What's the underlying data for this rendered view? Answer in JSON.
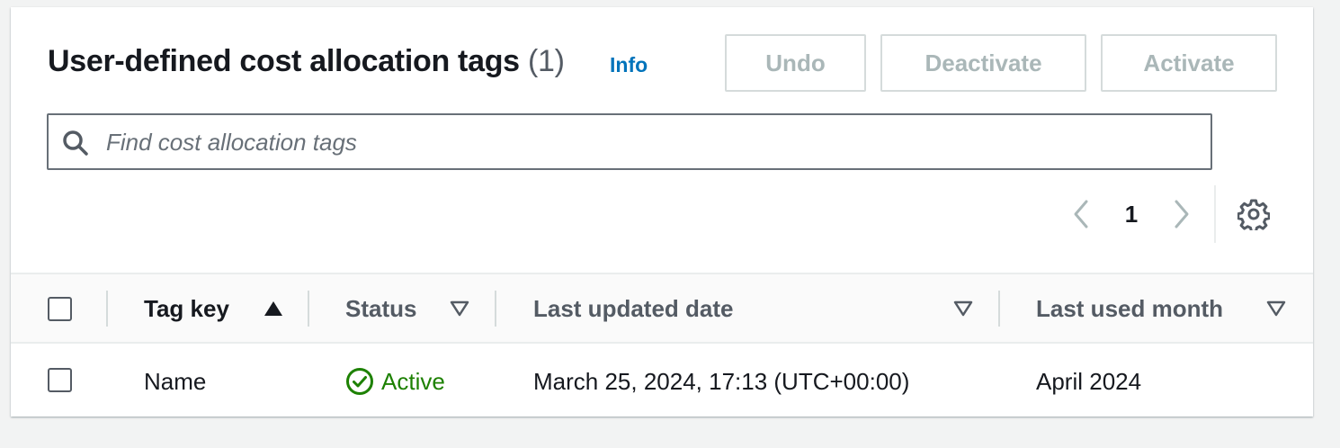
{
  "header": {
    "title": "User-defined cost allocation tags",
    "count": "(1)",
    "info_label": "Info"
  },
  "actions": {
    "undo_label": "Undo",
    "deactivate_label": "Deactivate",
    "activate_label": "Activate"
  },
  "search": {
    "placeholder": "Find cost allocation tags",
    "value": "",
    "icon": "search-icon"
  },
  "pagination": {
    "current_page": "1",
    "prev_icon": "chevron-left-icon",
    "next_icon": "chevron-right-icon",
    "settings_icon": "gear-icon"
  },
  "table": {
    "columns": [
      {
        "label": "Tag key",
        "sort": "ascending"
      },
      {
        "label": "Status",
        "sort": "none"
      },
      {
        "label": "Last updated date",
        "sort": "none"
      },
      {
        "label": "Last used month",
        "sort": "none"
      }
    ],
    "rows": [
      {
        "tag_key": "Name",
        "status": "Active",
        "last_updated": "March 25, 2024, 17:13 (UTC+00:00)",
        "last_used": "April 2024"
      }
    ]
  },
  "colors": {
    "link": "#0073bb",
    "active_status": "#1d8102",
    "disabled_text": "#aab7b8",
    "border": "#d5dbdb"
  }
}
